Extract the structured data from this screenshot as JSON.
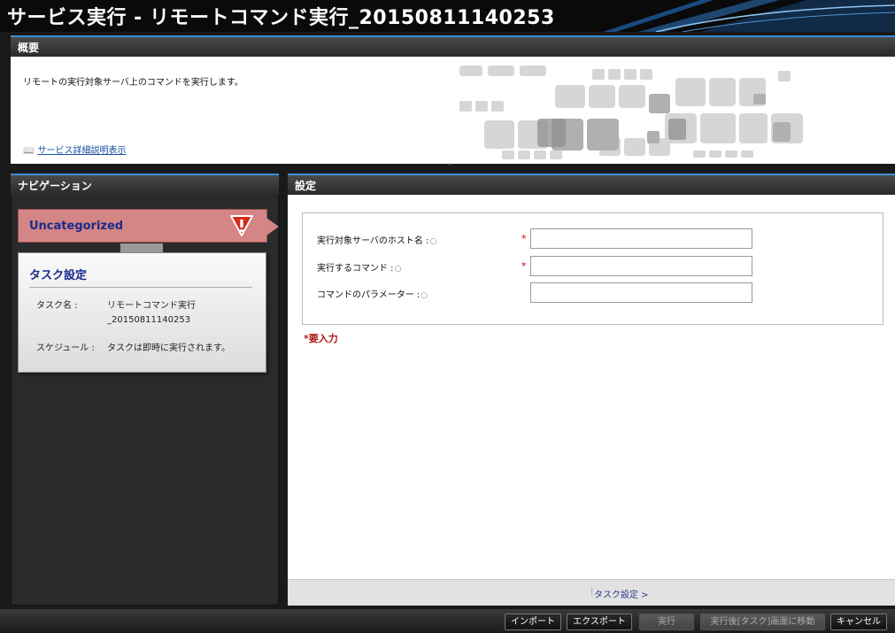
{
  "window": {
    "title": "サービス実行 - リモートコマンド実行_20150811140253"
  },
  "overview": {
    "header": "概要",
    "description": "リモートの実行対象サーバ上のコマンドを実行します。",
    "detail_link": "サービス詳細説明表示"
  },
  "navigation": {
    "header": "ナビゲーション",
    "category": "Uncategorized",
    "task_card": {
      "title": "タスク設定",
      "task_name_label": "タスク名 :",
      "task_name_line1": "リモートコマンド実行",
      "task_name_line2": "_20150811140253",
      "schedule_label": "スケジュール :",
      "schedule_value": "タスクは即時に実行されます。"
    }
  },
  "settings": {
    "header": "設定",
    "fields": [
      {
        "label": "実行対象サーバのホスト名 :",
        "required": true,
        "value": ""
      },
      {
        "label": "実行するコマンド :",
        "required": true,
        "value": ""
      },
      {
        "label": "コマンドのパラメーター :",
        "required": false,
        "value": ""
      }
    ],
    "required_mark": "*",
    "required_note": "*要入力",
    "footer_nav": "タスク設定 >"
  },
  "toolbar": {
    "import": "インポート",
    "export": "エクスポート",
    "run": "実行",
    "run_and_go": "実行後[タスク]画面に移動",
    "cancel": "キャンセル"
  },
  "colors": {
    "accent": "#3d8fd6",
    "category_bg": "#d48585",
    "link": "#1a4fa0",
    "required": "#cc0000"
  }
}
